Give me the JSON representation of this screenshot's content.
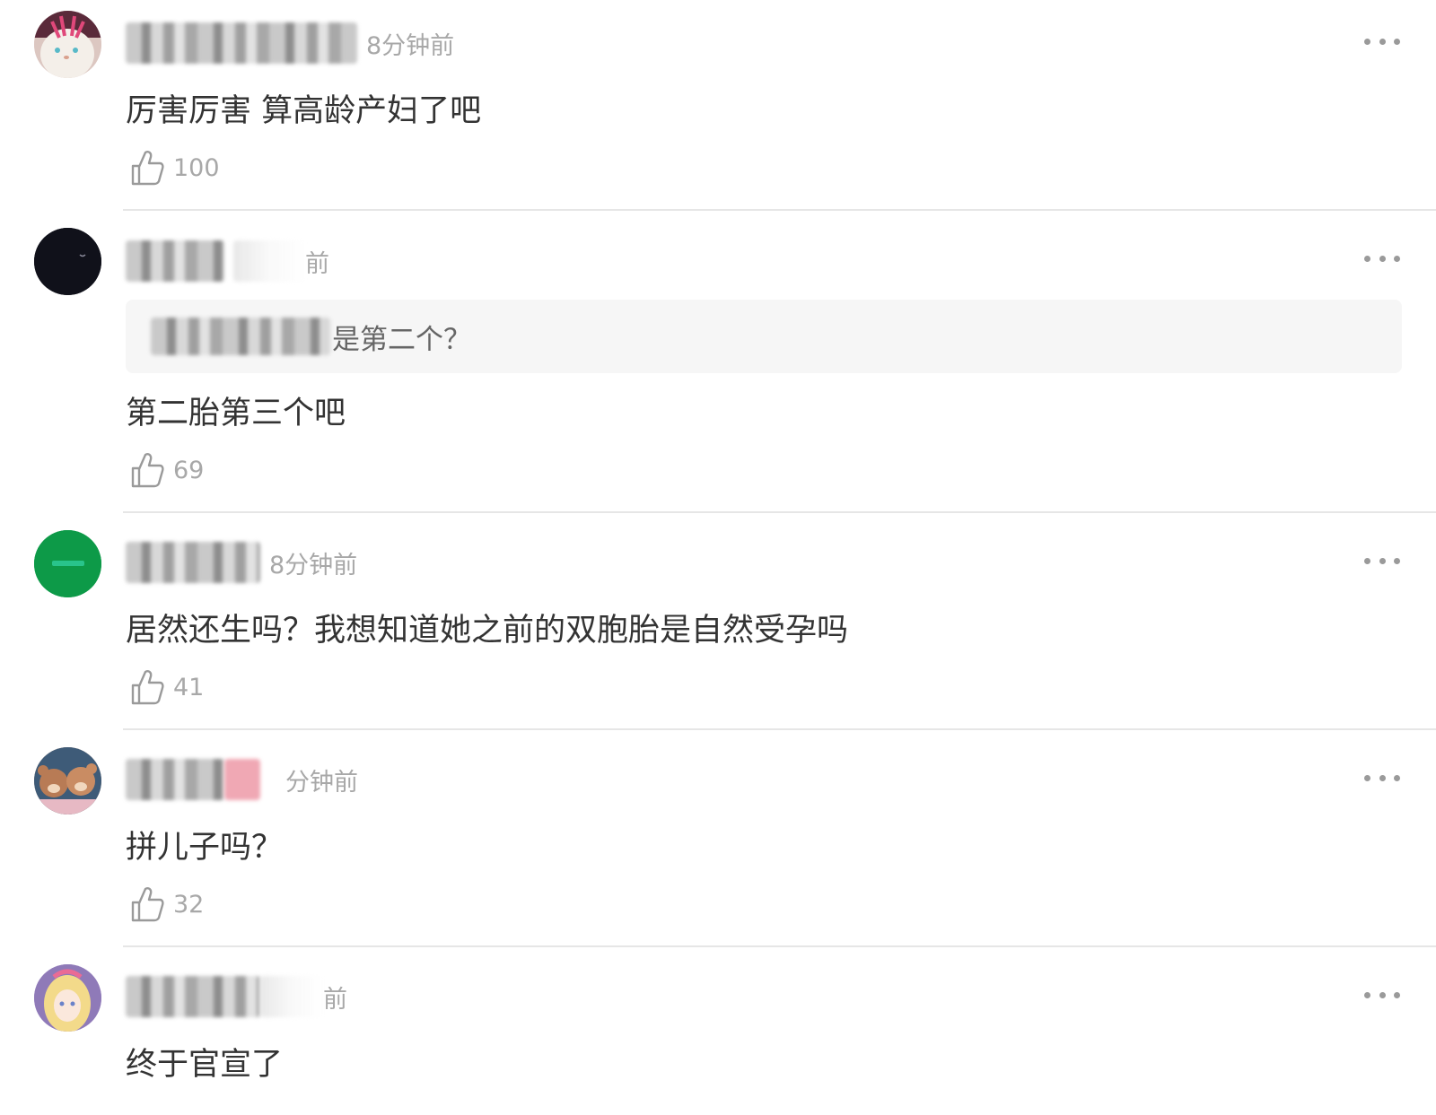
{
  "comments": [
    {
      "time": "8分钟前",
      "text": "厉害厉害 算高龄产妇了吧",
      "likes": "100",
      "avatar_icon": "bunny-plush-avatar"
    },
    {
      "time": "前",
      "quote": "是第二个？",
      "text": "第二胎第三个吧",
      "likes": "69",
      "avatar_icon": "dark-avatar"
    },
    {
      "time": "8分钟前",
      "text": "居然还生吗？我想知道她之前的双胞胎是自然受孕吗",
      "likes": "41",
      "avatar_icon": "green-avatar"
    },
    {
      "time": "分钟前",
      "text": "拼儿子吗？",
      "likes": "32",
      "avatar_icon": "teddy-bears-avatar"
    },
    {
      "time": "前",
      "text": "终于官宣了",
      "avatar_icon": "anime-girl-avatar"
    }
  ],
  "colors": {
    "green_avatar": "#0d9a48",
    "dark_avatar": "#10111a",
    "meta_text": "#a8a8a8",
    "body_text": "#333333",
    "quote_bg": "#f6f6f6"
  }
}
